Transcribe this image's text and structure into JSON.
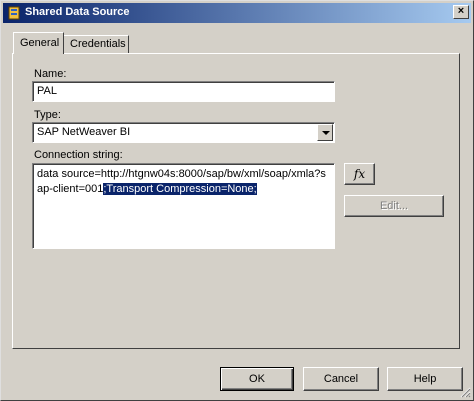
{
  "window": {
    "title": "Shared Data Source"
  },
  "tabs": [
    {
      "label": "General",
      "selected": true
    },
    {
      "label": "Credentials",
      "selected": false
    }
  ],
  "form": {
    "name_label": "Name:",
    "name_value": "PAL",
    "type_label": "Type:",
    "type_value": "SAP NetWeaver BI",
    "connection_label": "Connection string:",
    "connection_plain": "data source=http://htgnw04s:8000/sap/bw/xml/soap/xmla?sap-client=001",
    "connection_selected": ";Transport Compression=None;"
  },
  "buttons": {
    "fx_label": "fx",
    "edit_label": "Edit...",
    "ok_label": "OK",
    "cancel_label": "Cancel",
    "help_label": "Help"
  },
  "icons": {
    "app": "data-source-icon",
    "close": "close-icon",
    "expression": "function-icon"
  },
  "colors": {
    "titlebar_start": "#0a246a",
    "titlebar_end": "#a6caf0",
    "selection": "#0a246a",
    "face": "#d4d0c8"
  }
}
